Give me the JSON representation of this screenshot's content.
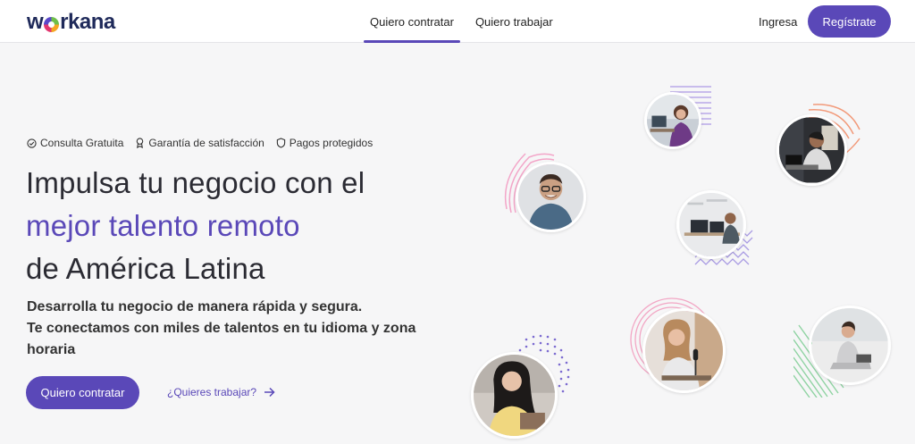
{
  "header": {
    "logo": {
      "prefix": "w",
      "suffix": "rkana"
    },
    "nav": [
      {
        "label": "Quiero contratar",
        "active": true
      },
      {
        "label": "Quiero trabajar",
        "active": false
      }
    ],
    "login": "Ingresa",
    "register": "Regístrate"
  },
  "hero": {
    "badges": [
      {
        "icon": "check-circle-icon",
        "label": "Consulta Gratuita"
      },
      {
        "icon": "award-icon",
        "label": "Garantía de satisfacción"
      },
      {
        "icon": "shield-icon",
        "label": "Pagos protegidos"
      }
    ],
    "headline": {
      "line1": "Impulsa tu negocio con el",
      "line2": "mejor talento remoto",
      "line3": "de América Latina"
    },
    "subtitle": {
      "line1": "Desarrolla tu negocio de manera rápida y segura.",
      "line2": "Te conectamos con miles de talentos en tu idioma y zona horaria"
    },
    "cta": "Quiero contratar",
    "work_link": "¿Quieres trabajar?"
  },
  "colors": {
    "accent": "#5a48b8",
    "text": "#2b2b33",
    "background": "#f6f6f7"
  }
}
